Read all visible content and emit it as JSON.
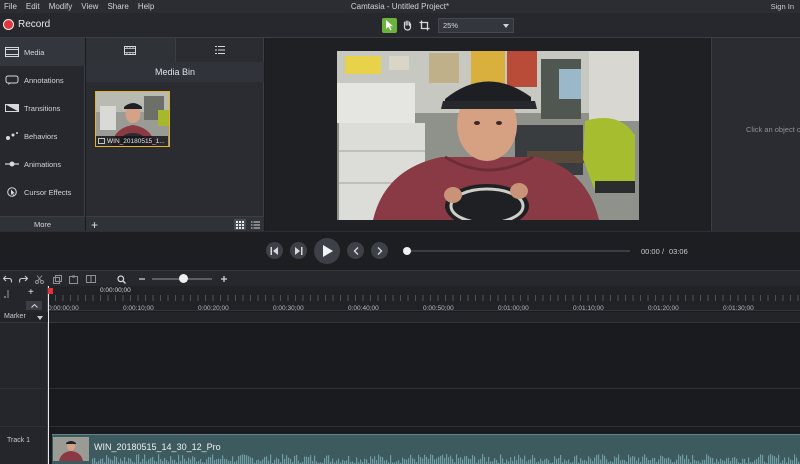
{
  "menubar": {
    "items": [
      "File",
      "Edit",
      "Modify",
      "View",
      "Share",
      "Help"
    ],
    "title": "Camtasia - Untitled Project*",
    "signin": "Sign In"
  },
  "toolbar": {
    "record_label": "Record",
    "zoom_value": "25%"
  },
  "tools": [
    {
      "label": "Media",
      "icon": "media-icon",
      "selected": true
    },
    {
      "label": "Annotations",
      "icon": "annotations-icon"
    },
    {
      "label": "Transitions",
      "icon": "transitions-icon"
    },
    {
      "label": "Behaviors",
      "icon": "behaviors-icon"
    },
    {
      "label": "Animations",
      "icon": "animations-icon"
    },
    {
      "label": "Cursor Effects",
      "icon": "cursor-effects-icon"
    }
  ],
  "more_label": "More",
  "media_bin": {
    "title": "Media Bin",
    "clip_name": "WIN_20180515_1..."
  },
  "properties": {
    "hint": "Click an object or canvas to show"
  },
  "playback": {
    "current_time": "00:00",
    "separator": "/",
    "total_time": "03:06",
    "progress": 0
  },
  "timeline": {
    "playhead_time": "0:00:00;00",
    "ruler_labels": [
      "0:00:00;00",
      "0:00:10;00",
      "0:00:20;00",
      "0:00:30;00",
      "0:00:40;00",
      "0:00:50;00",
      "0:01:00;00",
      "0:01:10;00",
      "0:01:20;00",
      "0:01:30;00"
    ],
    "marker_label": "Marker",
    "track_label": "Track 1",
    "clip_name": "WIN_20180515_14_30_12_Pro"
  },
  "colors": {
    "record": "#e5333b",
    "selection_accent": "#6bb33a",
    "clip_highlight": "#e6b422",
    "clip_track": "#3d5a5e"
  }
}
